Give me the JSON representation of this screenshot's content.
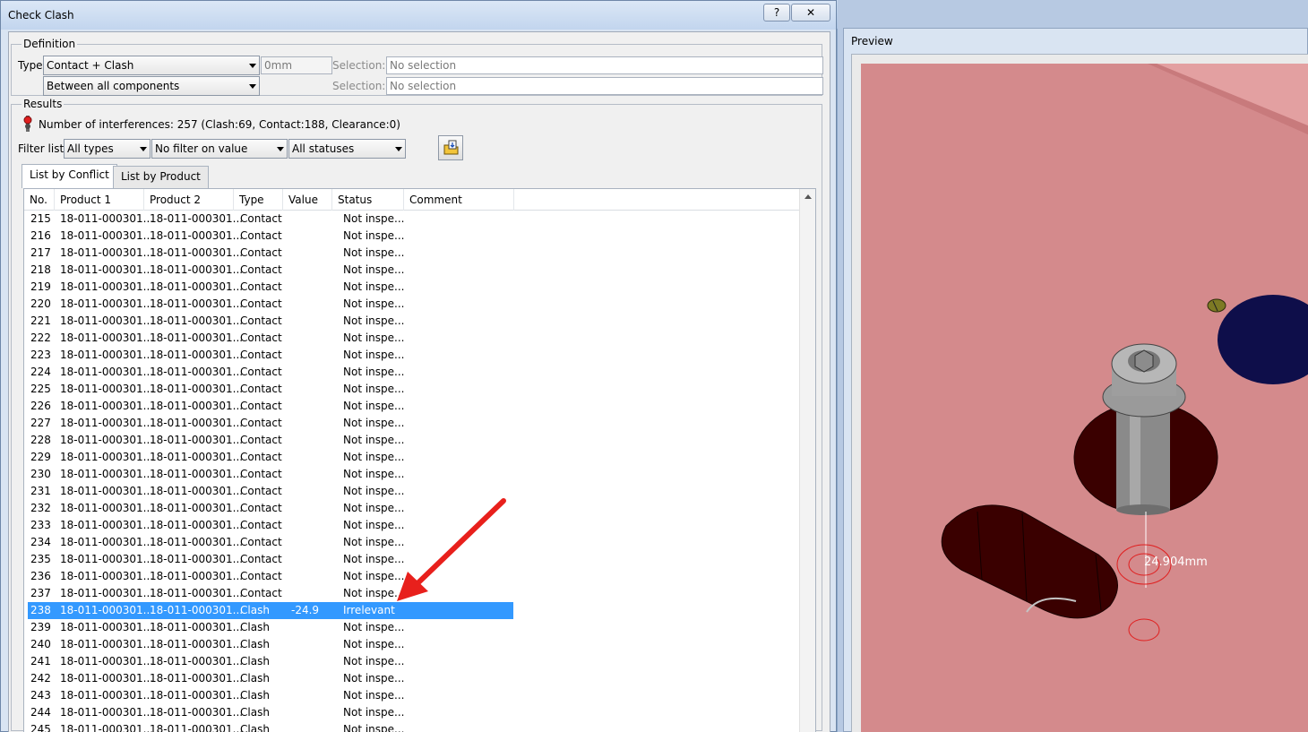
{
  "dialog": {
    "title": "Check Clash",
    "help_label": "?",
    "close_label": "✕"
  },
  "definition": {
    "group_label": "Definition",
    "type_label": "Type:",
    "type_value": "Contact + Clash",
    "scope_value": "Between all components",
    "clearance_value": "0mm",
    "selection1_label": "Selection: 1",
    "selection1_value": "No selection",
    "selection2_label": "Selection: 2",
    "selection2_value": "No selection"
  },
  "results": {
    "group_label": "Results",
    "summary": "Number of interferences: 257 (Clash:69, Contact:188, Clearance:0)",
    "filter_label": "Filter list:",
    "filter_type": "All types",
    "filter_value": "No filter on value",
    "filter_status": "All statuses"
  },
  "tabs": [
    {
      "label": "List by Conflict",
      "active": true
    },
    {
      "label": "List by Product",
      "active": false
    }
  ],
  "table": {
    "columns": [
      "No.",
      "Product 1",
      "Product 2",
      "Type",
      "Value",
      "Status",
      "Comment"
    ],
    "rows": [
      {
        "no": "215",
        "p1": "18-011-000301...",
        "p2": "18-011-000301...",
        "type": "Contact",
        "value": "",
        "status": "Not inspe..."
      },
      {
        "no": "216",
        "p1": "18-011-000301...",
        "p2": "18-011-000301...",
        "type": "Contact",
        "value": "",
        "status": "Not inspe..."
      },
      {
        "no": "217",
        "p1": "18-011-000301...",
        "p2": "18-011-000301...",
        "type": "Contact",
        "value": "",
        "status": "Not inspe..."
      },
      {
        "no": "218",
        "p1": "18-011-000301...",
        "p2": "18-011-000301...",
        "type": "Contact",
        "value": "",
        "status": "Not inspe..."
      },
      {
        "no": "219",
        "p1": "18-011-000301...",
        "p2": "18-011-000301...",
        "type": "Contact",
        "value": "",
        "status": "Not inspe..."
      },
      {
        "no": "220",
        "p1": "18-011-000301...",
        "p2": "18-011-000301...",
        "type": "Contact",
        "value": "",
        "status": "Not inspe..."
      },
      {
        "no": "221",
        "p1": "18-011-000301...",
        "p2": "18-011-000301...",
        "type": "Contact",
        "value": "",
        "status": "Not inspe..."
      },
      {
        "no": "222",
        "p1": "18-011-000301...",
        "p2": "18-011-000301...",
        "type": "Contact",
        "value": "",
        "status": "Not inspe..."
      },
      {
        "no": "223",
        "p1": "18-011-000301...",
        "p2": "18-011-000301...",
        "type": "Contact",
        "value": "",
        "status": "Not inspe..."
      },
      {
        "no": "224",
        "p1": "18-011-000301...",
        "p2": "18-011-000301...",
        "type": "Contact",
        "value": "",
        "status": "Not inspe..."
      },
      {
        "no": "225",
        "p1": "18-011-000301...",
        "p2": "18-011-000301...",
        "type": "Contact",
        "value": "",
        "status": "Not inspe..."
      },
      {
        "no": "226",
        "p1": "18-011-000301...",
        "p2": "18-011-000301...",
        "type": "Contact",
        "value": "",
        "status": "Not inspe..."
      },
      {
        "no": "227",
        "p1": "18-011-000301...",
        "p2": "18-011-000301...",
        "type": "Contact",
        "value": "",
        "status": "Not inspe..."
      },
      {
        "no": "228",
        "p1": "18-011-000301...",
        "p2": "18-011-000301...",
        "type": "Contact",
        "value": "",
        "status": "Not inspe..."
      },
      {
        "no": "229",
        "p1": "18-011-000301...",
        "p2": "18-011-000301...",
        "type": "Contact",
        "value": "",
        "status": "Not inspe..."
      },
      {
        "no": "230",
        "p1": "18-011-000301...",
        "p2": "18-011-000301...",
        "type": "Contact",
        "value": "",
        "status": "Not inspe..."
      },
      {
        "no": "231",
        "p1": "18-011-000301...",
        "p2": "18-011-000301...",
        "type": "Contact",
        "value": "",
        "status": "Not inspe..."
      },
      {
        "no": "232",
        "p1": "18-011-000301...",
        "p2": "18-011-000301...",
        "type": "Contact",
        "value": "",
        "status": "Not inspe..."
      },
      {
        "no": "233",
        "p1": "18-011-000301...",
        "p2": "18-011-000301...",
        "type": "Contact",
        "value": "",
        "status": "Not inspe..."
      },
      {
        "no": "234",
        "p1": "18-011-000301...",
        "p2": "18-011-000301...",
        "type": "Contact",
        "value": "",
        "status": "Not inspe..."
      },
      {
        "no": "235",
        "p1": "18-011-000301...",
        "p2": "18-011-000301...",
        "type": "Contact",
        "value": "",
        "status": "Not inspe..."
      },
      {
        "no": "236",
        "p1": "18-011-000301...",
        "p2": "18-011-000301...",
        "type": "Contact",
        "value": "",
        "status": "Not inspe..."
      },
      {
        "no": "237",
        "p1": "18-011-000301...",
        "p2": "18-011-000301...",
        "type": "Contact",
        "value": "",
        "status": "Not inspe..."
      },
      {
        "no": "238",
        "p1": "18-011-000301...",
        "p2": "18-011-000301...",
        "type": "Clash",
        "value": "-24.9",
        "status": "Irrelevant",
        "selected": true
      },
      {
        "no": "239",
        "p1": "18-011-000301...",
        "p2": "18-011-000301...",
        "type": "Clash",
        "value": "",
        "status": "Not inspe..."
      },
      {
        "no": "240",
        "p1": "18-011-000301...",
        "p2": "18-011-000301...",
        "type": "Clash",
        "value": "",
        "status": "Not inspe..."
      },
      {
        "no": "241",
        "p1": "18-011-000301...",
        "p2": "18-011-000301...",
        "type": "Clash",
        "value": "",
        "status": "Not inspe..."
      },
      {
        "no": "242",
        "p1": "18-011-000301...",
        "p2": "18-011-000301...",
        "type": "Clash",
        "value": "",
        "status": "Not inspe..."
      },
      {
        "no": "243",
        "p1": "18-011-000301...",
        "p2": "18-011-000301...",
        "type": "Clash",
        "value": "",
        "status": "Not inspe..."
      },
      {
        "no": "244",
        "p1": "18-011-000301...",
        "p2": "18-011-000301...",
        "type": "Clash",
        "value": "",
        "status": "Not inspe..."
      },
      {
        "no": "245",
        "p1": "18-011-000301...",
        "p2": "18-011-000301...",
        "type": "Clash",
        "value": "",
        "status": "Not inspe..."
      }
    ]
  },
  "preview": {
    "title": "Preview",
    "measurement": "24.904mm"
  },
  "colors": {
    "selection": "#3399ff",
    "preview_background": "#d48a8c",
    "annotation_arrow": "#e8201c"
  },
  "icons": [
    "status-light-icon",
    "export-report-icon",
    "scroll-up-icon",
    "dropdown-arrow-icon"
  ]
}
